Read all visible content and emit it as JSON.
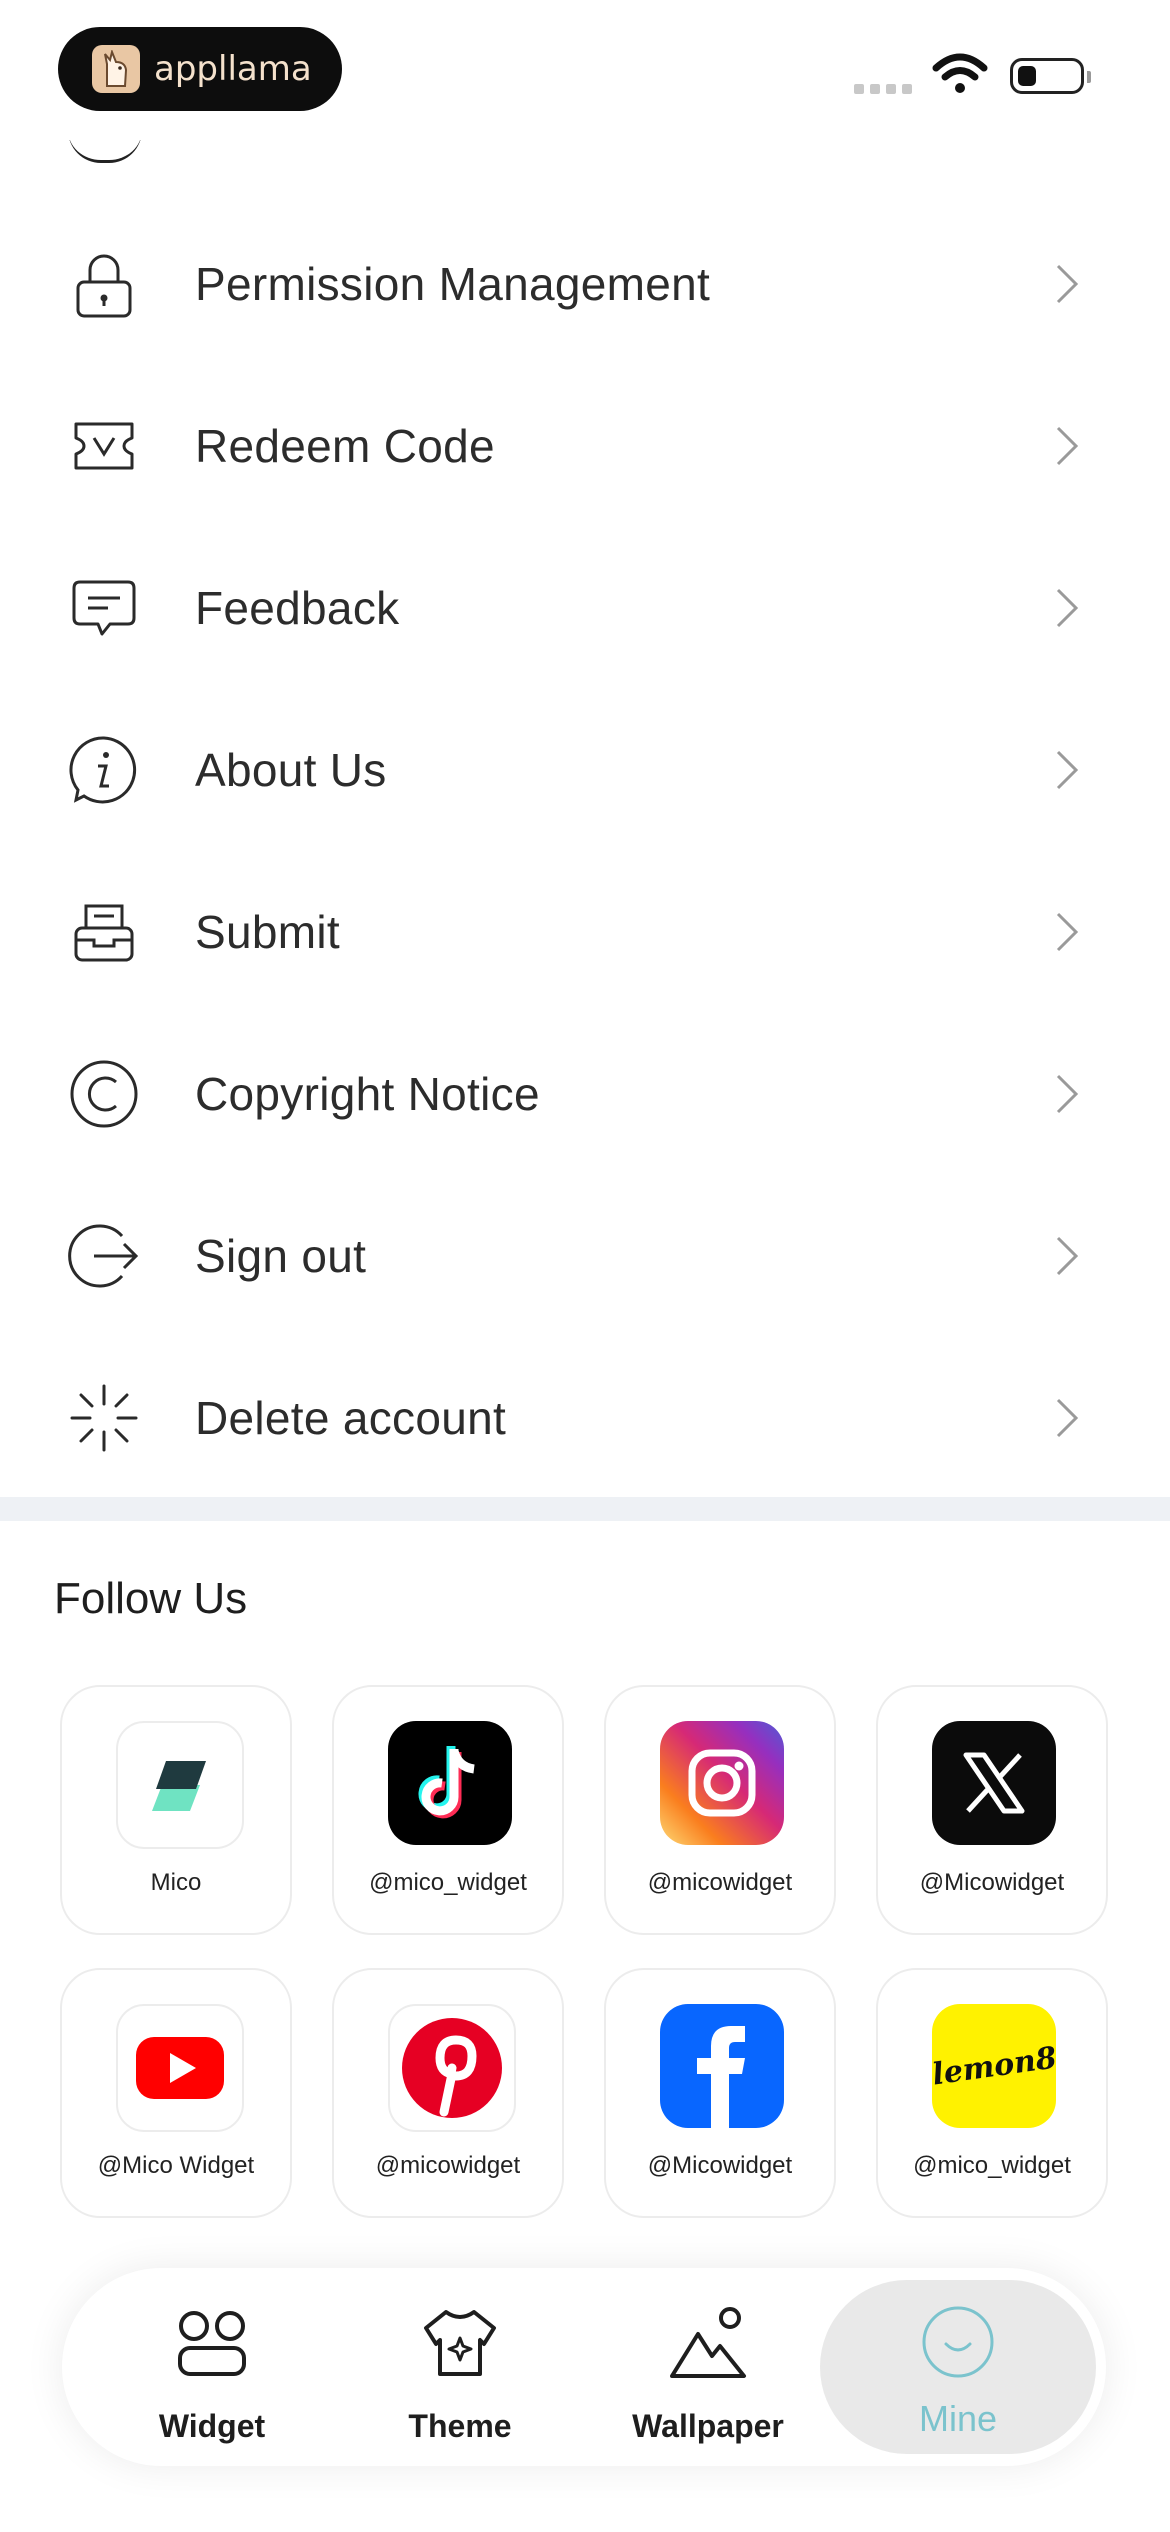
{
  "status_bar": {
    "app_name": "appllama"
  },
  "menu": {
    "items": [
      {
        "label": "Permission Management",
        "icon": "lock-icon"
      },
      {
        "label": "Redeem Code",
        "icon": "ticket-icon"
      },
      {
        "label": "Feedback",
        "icon": "chat-bubble-icon"
      },
      {
        "label": "About Us",
        "icon": "info-icon"
      },
      {
        "label": "Submit",
        "icon": "inbox-tray-icon"
      },
      {
        "label": "Copyright Notice",
        "icon": "copyright-icon"
      },
      {
        "label": "Sign out",
        "icon": "sign-out-icon"
      },
      {
        "label": "Delete account",
        "icon": "burst-icon"
      }
    ]
  },
  "follow": {
    "title": "Follow Us",
    "accounts": [
      {
        "handle": "Mico",
        "platform": "mico"
      },
      {
        "handle": "@mico_widget",
        "platform": "tiktok"
      },
      {
        "handle": "@micowidget",
        "platform": "instagram"
      },
      {
        "handle": "@Micowidget",
        "platform": "x"
      },
      {
        "handle": "@Mico Widget",
        "platform": "youtube"
      },
      {
        "handle": "@micowidget",
        "platform": "pinterest"
      },
      {
        "handle": "@Micowidget",
        "platform": "facebook"
      },
      {
        "handle": "@mico_widget",
        "platform": "lemon8",
        "logo_text": "lemon8"
      }
    ]
  },
  "tabbar": {
    "tabs": [
      {
        "label": "Widget",
        "icon": "widget-grid-icon"
      },
      {
        "label": "Theme",
        "icon": "shirt-sparkle-icon"
      },
      {
        "label": "Wallpaper",
        "icon": "mountain-icon"
      },
      {
        "label": "Mine",
        "icon": "smile-face-icon",
        "active": true
      }
    ]
  },
  "colors": {
    "accent": "#7bc3cd",
    "divider": "#eef1f5",
    "text": "#2c2c2c"
  }
}
